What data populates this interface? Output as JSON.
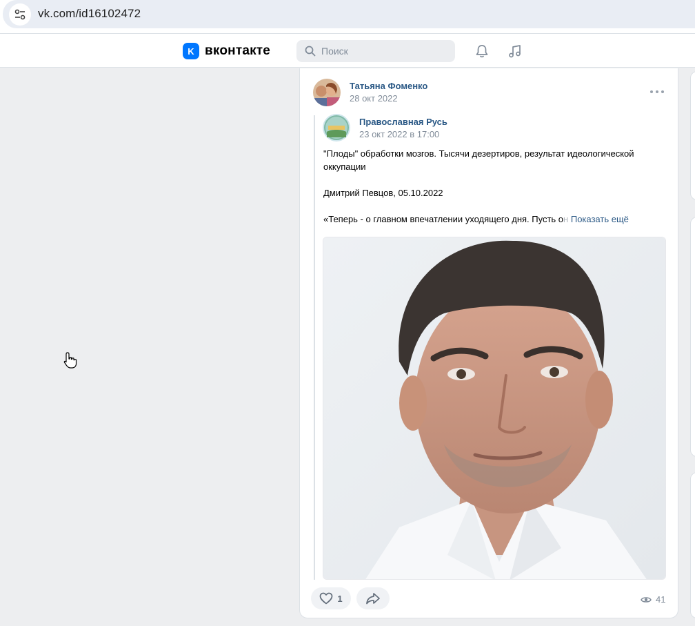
{
  "browser": {
    "url": "vk.com/id16102472"
  },
  "header": {
    "logo_mark": "K",
    "logo_text": "вконтакте",
    "search_placeholder": "Поиск"
  },
  "post": {
    "author": "Татьяна Фоменко",
    "date": "28 окт 2022",
    "repost": {
      "author": "Православная Русь",
      "date": "23 окт 2022 в 17:00",
      "text_line1": "\"Плоды\" обработки мозгов. Тысячи дезертиров, результат идеологической",
      "text_line2": "оккупации",
      "text_line3": "Дмитрий Певцов, 05.10.2022",
      "text_line4": "«Теперь - о главном впечатлении уходящего дня. Пусть о",
      "text_fade": "н",
      "show_more": "Показать ещё"
    },
    "likes": "1",
    "views": "41"
  },
  "colors": {
    "accent": "#0077ff",
    "link": "#2a5885",
    "muted": "#818c99"
  },
  "icons": [
    "site-settings-icon",
    "search-icon",
    "bell-icon",
    "music-icon",
    "more-icon",
    "heart-icon",
    "share-icon",
    "eye-icon",
    "hand-cursor-icon"
  ]
}
